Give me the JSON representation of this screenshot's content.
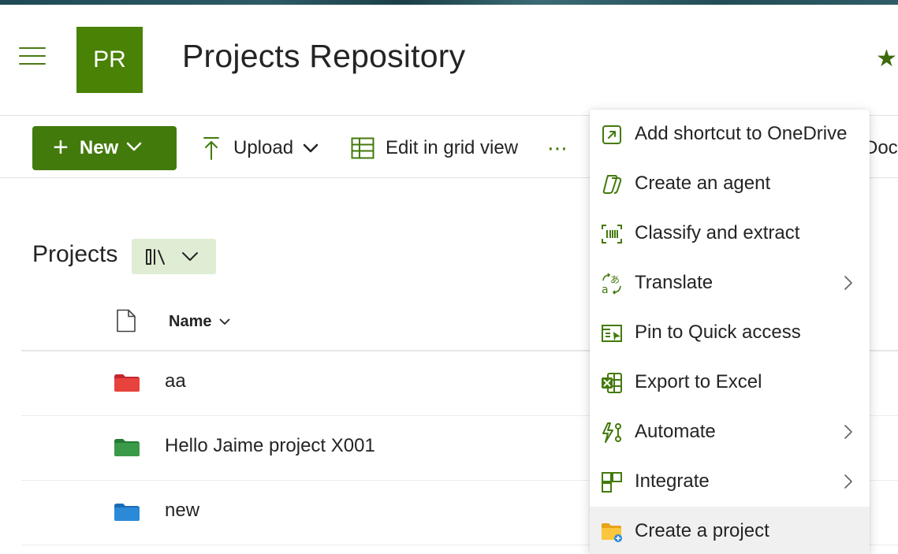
{
  "header": {
    "site_initials": "PR",
    "site_title": "Projects Repository",
    "favorite_icon": "star-icon"
  },
  "commandbar": {
    "new_label": "New",
    "upload_label": "Upload",
    "edit_grid_label": "Edit in grid view",
    "more_label": "⋯",
    "clipped_label": "Docu"
  },
  "library": {
    "title": "Projects",
    "view_icon": "library-icon"
  },
  "columns": {
    "name_header": "Name"
  },
  "rows": [
    {
      "name": "aa",
      "folder_color": "#d13438"
    },
    {
      "name": "Hello Jaime project X001",
      "folder_color": "#37993a"
    },
    {
      "name": "new",
      "folder_color": "#2b88d8"
    }
  ],
  "menu": {
    "items": [
      {
        "label": "Add shortcut to OneDrive",
        "icon": "shortcut-icon",
        "has_submenu": false
      },
      {
        "label": "Create an agent",
        "icon": "agent-icon",
        "has_submenu": false
      },
      {
        "label": "Classify and extract",
        "icon": "classify-icon",
        "has_submenu": false
      },
      {
        "label": "Translate",
        "icon": "translate-icon",
        "has_submenu": true
      },
      {
        "label": "Pin to Quick access",
        "icon": "pin-icon",
        "has_submenu": false
      },
      {
        "label": "Export to Excel",
        "icon": "excel-icon",
        "has_submenu": false
      },
      {
        "label": "Automate",
        "icon": "automate-icon",
        "has_submenu": true
      },
      {
        "label": "Integrate",
        "icon": "integrate-icon",
        "has_submenu": true
      },
      {
        "label": "Create a project",
        "icon": "project-folder-icon",
        "has_submenu": false
      }
    ]
  },
  "colors": {
    "accent": "#437a0c",
    "site_logo": "#498205",
    "view_button_bg": "#dfedd4"
  }
}
